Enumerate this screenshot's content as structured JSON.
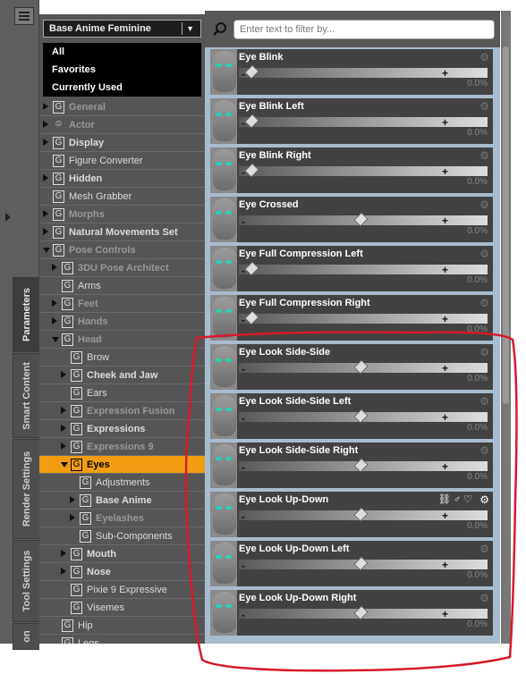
{
  "side_tabs": [
    "Parameters",
    "Smart Content",
    "Render Settings",
    "Tool Settings",
    "on"
  ],
  "preset_dropdown": {
    "value": "Base Anime Feminine"
  },
  "favorites": [
    "All",
    "Favorites",
    "Currently Used"
  ],
  "tree": [
    {
      "label": "General",
      "indent": 0,
      "arrow": "right",
      "style": "dim"
    },
    {
      "label": "Actor",
      "indent": 0,
      "arrow": "right",
      "style": "dim",
      "icon": "actor-icon"
    },
    {
      "label": "Display",
      "indent": 0,
      "arrow": "right",
      "style": "bold"
    },
    {
      "label": "Figure Converter",
      "indent": 0,
      "arrow": "",
      "style": ""
    },
    {
      "label": "Hidden",
      "indent": 0,
      "arrow": "right",
      "style": "bold"
    },
    {
      "label": "Mesh Grabber",
      "indent": 0,
      "arrow": "",
      "style": ""
    },
    {
      "label": "Morphs",
      "indent": 0,
      "arrow": "right",
      "style": "dim"
    },
    {
      "label": "Natural Movements Set",
      "indent": 0,
      "arrow": "right",
      "style": "bold"
    },
    {
      "label": "Pose Controls",
      "indent": 0,
      "arrow": "down",
      "style": "dim"
    },
    {
      "label": "3DU Pose Architect",
      "indent": 1,
      "arrow": "right",
      "style": "dim"
    },
    {
      "label": "Arms",
      "indent": 1,
      "arrow": "",
      "style": ""
    },
    {
      "label": "Feet",
      "indent": 1,
      "arrow": "right",
      "style": "dim"
    },
    {
      "label": "Hands",
      "indent": 1,
      "arrow": "right",
      "style": "dim"
    },
    {
      "label": "Head",
      "indent": 1,
      "arrow": "down",
      "style": "dim"
    },
    {
      "label": "Brow",
      "indent": 2,
      "arrow": "",
      "style": ""
    },
    {
      "label": "Cheek and Jaw",
      "indent": 2,
      "arrow": "right",
      "style": "bold"
    },
    {
      "label": "Ears",
      "indent": 2,
      "arrow": "",
      "style": ""
    },
    {
      "label": "Expression Fusion",
      "indent": 2,
      "arrow": "right",
      "style": "dim"
    },
    {
      "label": "Expressions",
      "indent": 2,
      "arrow": "right",
      "style": "bold"
    },
    {
      "label": "Expressions 9",
      "indent": 2,
      "arrow": "right",
      "style": "dim"
    },
    {
      "label": "Eyes",
      "indent": 2,
      "arrow": "down",
      "style": "sel"
    },
    {
      "label": "Adjustments",
      "indent": 3,
      "arrow": "",
      "style": ""
    },
    {
      "label": "Base Anime",
      "indent": 3,
      "arrow": "right",
      "style": "bold"
    },
    {
      "label": "Eyelashes",
      "indent": 3,
      "arrow": "right",
      "style": "dim"
    },
    {
      "label": "Sub-Components",
      "indent": 3,
      "arrow": "",
      "style": ""
    },
    {
      "label": "Mouth",
      "indent": 2,
      "arrow": "right",
      "style": "bold"
    },
    {
      "label": "Nose",
      "indent": 2,
      "arrow": "right",
      "style": "bold"
    },
    {
      "label": "Pixie 9 Expressive",
      "indent": 2,
      "arrow": "",
      "style": ""
    },
    {
      "label": "Visemes",
      "indent": 2,
      "arrow": "",
      "style": ""
    },
    {
      "label": "Hip",
      "indent": 1,
      "arrow": "",
      "style": ""
    },
    {
      "label": "Legs",
      "indent": 1,
      "arrow": "",
      "style": ""
    }
  ],
  "search": {
    "placeholder": "Enter text to filter by..."
  },
  "properties": [
    {
      "name": "Eye Blink",
      "value": "0.0%",
      "pos": 0.0,
      "icons": false
    },
    {
      "name": "Eye Blink Left",
      "value": "0.0%",
      "pos": 0.0,
      "icons": false
    },
    {
      "name": "Eye Blink Right",
      "value": "0.0%",
      "pos": 0.0,
      "icons": false
    },
    {
      "name": "Eye Crossed",
      "value": "0.0%",
      "pos": 0.5,
      "icons": false
    },
    {
      "name": "Eye Full Compression Left",
      "value": "0.0%",
      "pos": 0.0,
      "icons": false
    },
    {
      "name": "Eye Full Compression Right",
      "value": "0.0%",
      "pos": 0.0,
      "icons": false
    },
    {
      "name": "Eye Look Side-Side",
      "value": "0.0%",
      "pos": 0.5,
      "icons": false
    },
    {
      "name": "Eye Look Side-Side Left",
      "value": "0.0%",
      "pos": 0.5,
      "icons": false
    },
    {
      "name": "Eye Look Side-Side Right",
      "value": "0.0%",
      "pos": 0.5,
      "icons": false
    },
    {
      "name": "Eye Look Up-Down",
      "value": "0.0%",
      "pos": 0.5,
      "icons": true
    },
    {
      "name": "Eye Look Up-Down Left",
      "value": "0.0%",
      "pos": 0.5,
      "icons": false
    },
    {
      "name": "Eye Look Up-Down Right",
      "value": "0.0%",
      "pos": 0.5,
      "icons": false
    }
  ],
  "colors": {
    "selected": "#f29d12",
    "annotation": "#d8192c",
    "eye_glow": "#1fd6b4"
  }
}
